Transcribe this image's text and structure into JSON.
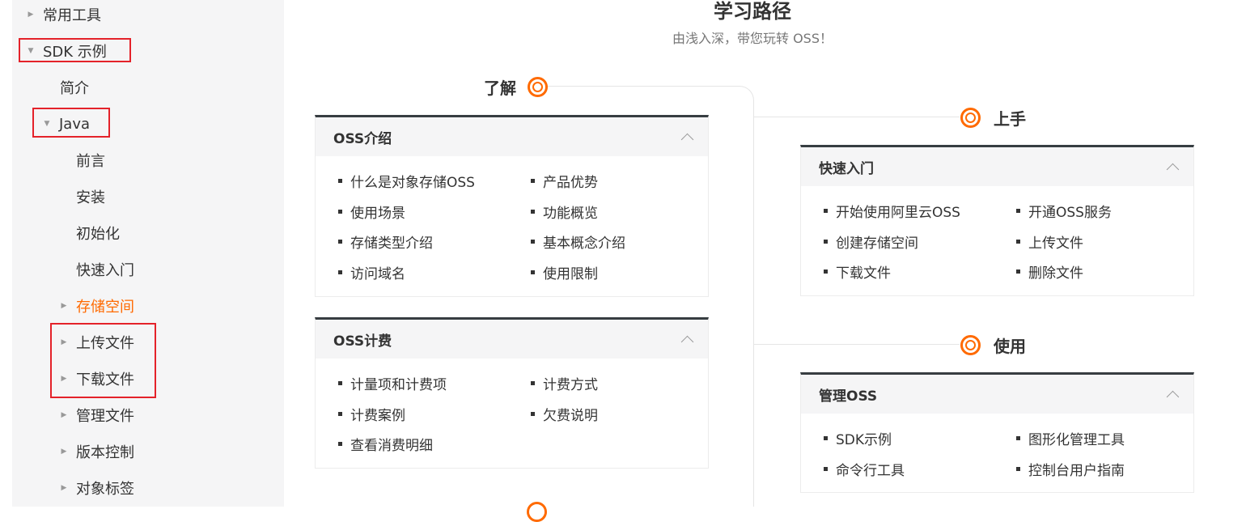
{
  "sidebar": {
    "items": [
      {
        "label": "常用工具",
        "state": "collapsed"
      },
      {
        "label": "SDK 示例",
        "state": "expanded"
      },
      {
        "label": "简介",
        "state": "leaf"
      },
      {
        "label": "Java",
        "state": "expanded"
      },
      {
        "label": "前言",
        "state": "leaf"
      },
      {
        "label": "安装",
        "state": "leaf"
      },
      {
        "label": "初始化",
        "state": "leaf"
      },
      {
        "label": "快速入门",
        "state": "leaf"
      },
      {
        "label": "存储空间",
        "state": "collapsed",
        "active": true
      },
      {
        "label": "上传文件",
        "state": "collapsed"
      },
      {
        "label": "下载文件",
        "state": "collapsed"
      },
      {
        "label": "管理文件",
        "state": "collapsed"
      },
      {
        "label": "版本控制",
        "state": "collapsed"
      },
      {
        "label": "对象标签",
        "state": "collapsed"
      }
    ]
  },
  "header": {
    "title": "学习路径",
    "subtitle": "由浅入深，带您玩转 OSS！"
  },
  "stages": {
    "learn": "了解",
    "start": "上手",
    "use": "使用"
  },
  "cards": {
    "intro": {
      "title": "OSS介绍",
      "links": [
        "什么是对象存储OSS",
        "产品优势",
        "使用场景",
        "功能概览",
        "存储类型介绍",
        "基本概念介绍",
        "访问域名",
        "使用限制"
      ]
    },
    "billing": {
      "title": "OSS计费",
      "links": [
        "计量项和计费项",
        "计费方式",
        "计费案例",
        "欠费说明",
        "查看消费明细"
      ]
    },
    "quickstart": {
      "title": "快速入门",
      "links": [
        "开始使用阿里云OSS",
        "开通OSS服务",
        "创建存储空间",
        "上传文件",
        "下载文件",
        "删除文件"
      ]
    },
    "manage": {
      "title": "管理OSS",
      "links": [
        "SDK示例",
        "图形化管理工具",
        "命令行工具",
        "控制台用户指南"
      ]
    }
  },
  "colors": {
    "accent": "#ff6a00",
    "highlight_box": "#e4222a",
    "card_top_border": "#373d41",
    "sidebar_bg": "#f5f5f6"
  }
}
